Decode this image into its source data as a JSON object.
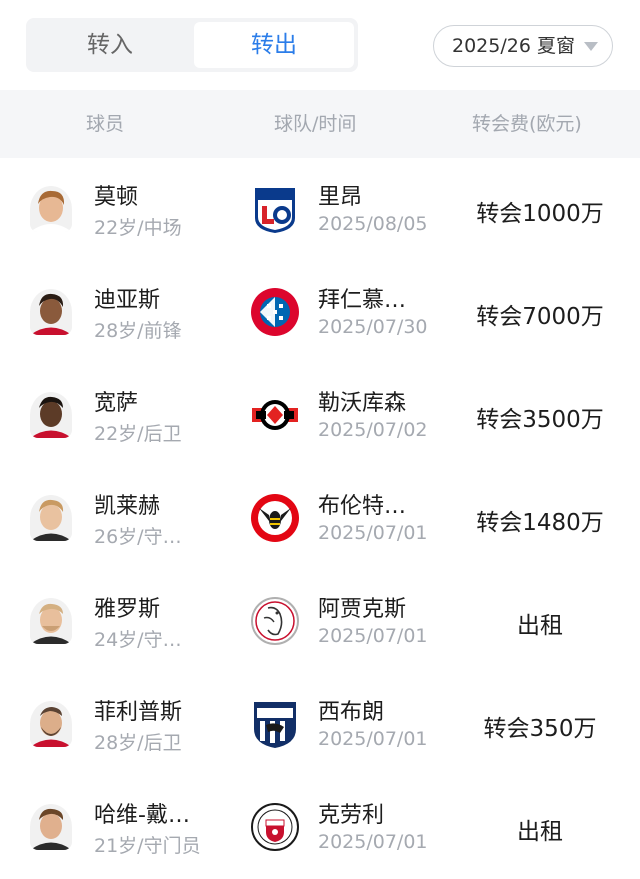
{
  "tabs": [
    {
      "label": "转入",
      "active": false
    },
    {
      "label": "转出",
      "active": true
    }
  ],
  "season": {
    "label": "2025/26 夏窗"
  },
  "columns": {
    "player": "球员",
    "team_time": "球队/时间",
    "fee": "转会费(欧元)"
  },
  "colors": {
    "accent": "#2b7de9",
    "header_bg": "#f5f6f8",
    "muted_text": "#a5a9b0"
  },
  "rows": [
    {
      "name": "莫顿",
      "info": "22岁/中场",
      "team": "里昂",
      "date": "2025/08/05",
      "fee": "转会1000万",
      "crest": "lyon-crest-icon"
    },
    {
      "name": "迪亚斯",
      "info": "28岁/前锋",
      "team": "拜仁慕…",
      "date": "2025/07/30",
      "fee": "转会7000万",
      "crest": "bayern-crest-icon"
    },
    {
      "name": "宽萨",
      "info": "22岁/后卫",
      "team": "勒沃库森",
      "date": "2025/07/02",
      "fee": "转会3500万",
      "crest": "leverkusen-crest-icon"
    },
    {
      "name": "凯莱赫",
      "info": "26岁/守…",
      "team": "布伦特…",
      "date": "2025/07/01",
      "fee": "转会1480万",
      "crest": "brentford-crest-icon"
    },
    {
      "name": "雅罗斯",
      "info": "24岁/守…",
      "team": "阿贾克斯",
      "date": "2025/07/01",
      "fee": "出租",
      "crest": "ajax-crest-icon"
    },
    {
      "name": "菲利普斯",
      "info": "28岁/后卫",
      "team": "西布朗",
      "date": "2025/07/01",
      "fee": "转会350万",
      "crest": "west-brom-crest-icon"
    },
    {
      "name": "哈维-戴…",
      "info": "21岁/守门员",
      "team": "克劳利",
      "date": "2025/07/01",
      "fee": "出租",
      "crest": "crawley-crest-icon"
    }
  ]
}
